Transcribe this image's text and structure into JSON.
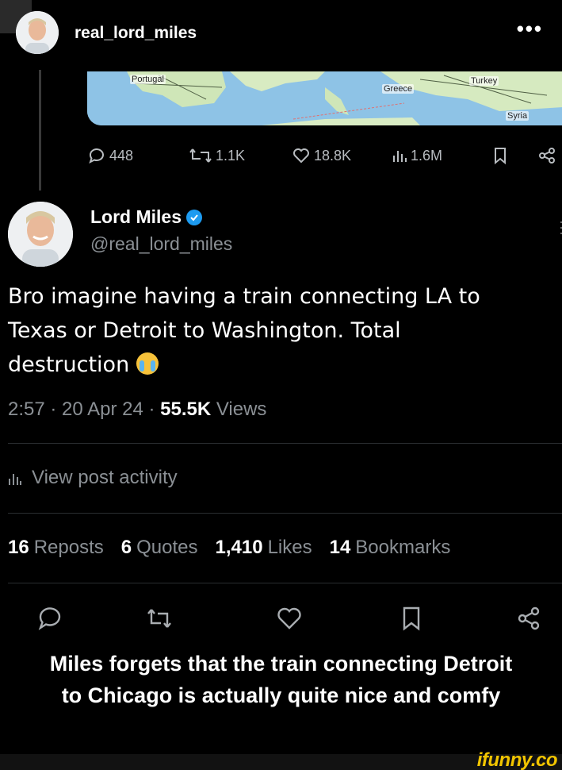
{
  "header": {
    "username": "real_lord_miles",
    "more_label": "•••"
  },
  "quoted_post": {
    "map_labels": [
      "Portugal",
      "Greece",
      "Turkey",
      "Syria"
    ],
    "stats": {
      "replies": "448",
      "reposts": "1.1K",
      "likes": "18.8K",
      "views": "1.6M"
    }
  },
  "post": {
    "author_name": "Lord Miles",
    "author_handle": "@real_lord_miles",
    "text": "Bro imagine having a train connecting LA to Texas or Detroit to Washington. Total destruction",
    "time": "2:57",
    "date": "20 Apr 24",
    "views_count": "55.5K",
    "views_label": "Views",
    "activity_label": "View post activity",
    "stats": [
      {
        "count": "16",
        "label": "Reposts"
      },
      {
        "count": "6",
        "label": "Quotes"
      },
      {
        "count": "1,410",
        "label": "Likes"
      },
      {
        "count": "14",
        "label": "Bookmarks"
      }
    ]
  },
  "caption": {
    "line1": "Miles forgets that the train connecting Detroit",
    "line2": "to Chicago is actually quite nice and comfy"
  },
  "watermark": "ifunny.co",
  "colors": {
    "background": "#000000",
    "secondary_text": "#8b9095",
    "verified": "#1d9bf0",
    "watermark": "#f2c500"
  }
}
